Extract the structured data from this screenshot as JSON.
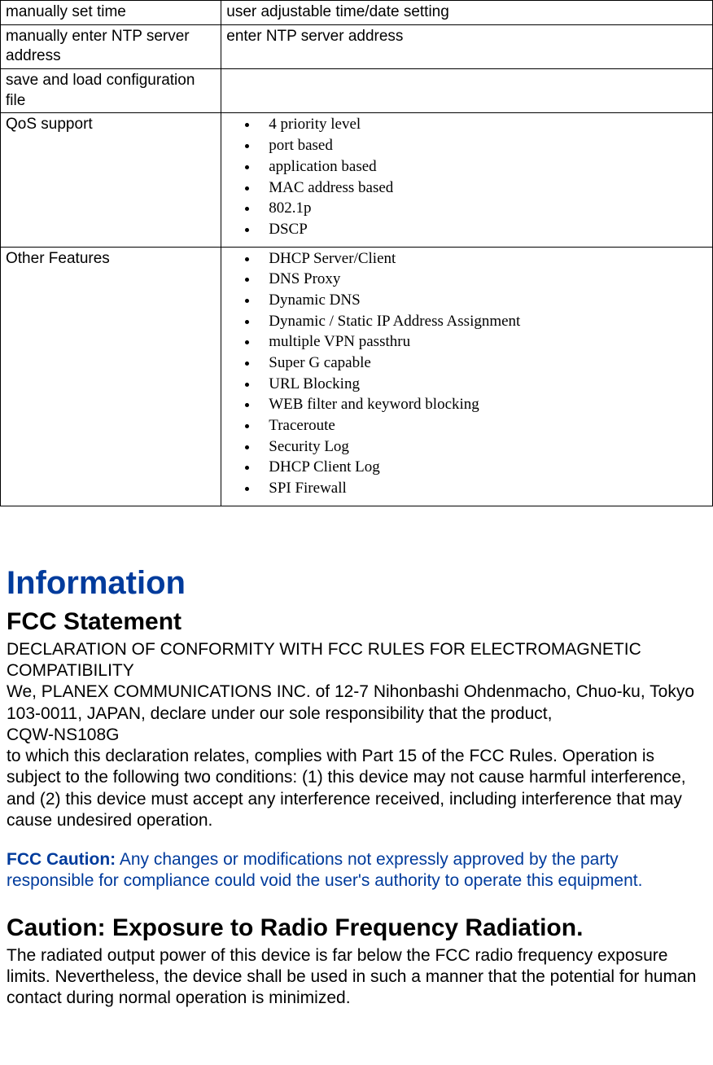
{
  "table": {
    "rows": [
      {
        "left": "manually set time",
        "right_type": "text",
        "right": "user adjustable time/date setting"
      },
      {
        "left": "manually enter NTP server address",
        "right_type": "text",
        "right": "enter NTP server address"
      },
      {
        "left": "save and load configuration file",
        "right_type": "empty",
        "right": ""
      },
      {
        "left": "QoS support",
        "right_type": "list",
        "right": [
          "4 priority level",
          "port based",
          "application based",
          "MAC address based",
          "802.1p",
          "DSCP"
        ]
      },
      {
        "left": "Other Features",
        "right_type": "list",
        "right": [
          "DHCP Server/Client",
          "DNS Proxy",
          "Dynamic DNS",
          "Dynamic / Static IP Address Assignment",
          "multiple VPN passthru",
          "Super G capable",
          "URL Blocking",
          "WEB filter and keyword blocking",
          "Traceroute",
          "Security Log",
          "DHCP Client Log",
          "SPI Firewall"
        ]
      }
    ]
  },
  "info": {
    "title": "Information",
    "fcc_heading": "FCC Statement",
    "declaration_line1": "DECLARATION OF CONFORMITY WITH FCC RULES FOR ELECTROMAGNETIC COMPATIBILITY",
    "declaration_line2": "We, PLANEX COMMUNICATIONS INC. of 12-7 Nihonbashi Ohdenmacho, Chuo-ku, Tokyo 103-0011, JAPAN, declare under our sole responsibility that the product,",
    "model": "CQW-NS108G",
    "declaration_line3": "to which this declaration relates, complies with Part 15 of the FCC Rules. Operation is subject to the following two conditions: (1) this device may not cause harmful interference, and (2) this device must accept any interference received, including interference that may cause undesired operation.",
    "fcc_caution_label": "FCC Caution:",
    "fcc_caution_text": " Any changes or modifications not expressly approved by the party responsible for compliance could void the user's authority to operate this equipment.",
    "rf_heading": "Caution: Exposure to Radio Frequency Radiation.",
    "rf_text": "The radiated output power of this device is far below the FCC radio frequency exposure limits. Nevertheless, the device shall be used in such a manner that the potential for human contact during normal operation is minimized."
  }
}
